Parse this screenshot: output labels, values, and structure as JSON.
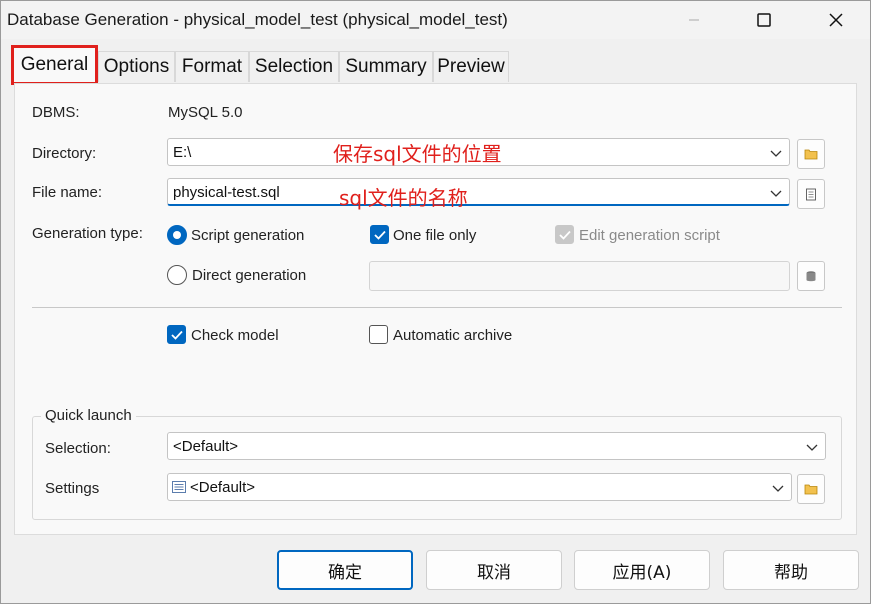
{
  "window": {
    "title": "Database Generation - physical_model_test (physical_model_test)"
  },
  "tabs": [
    {
      "label": "General",
      "active": true
    },
    {
      "label": "Options"
    },
    {
      "label": "Format"
    },
    {
      "label": "Selection"
    },
    {
      "label": "Summary"
    },
    {
      "label": "Preview"
    }
  ],
  "general": {
    "dbms_label": "DBMS:",
    "dbms_value": "MySQL 5.0",
    "directory_label": "Directory:",
    "directory_value": "E:\\",
    "directory_annotation": "保存sql文件的位置",
    "filename_label": "File name:",
    "filename_value": "physical-test.sql",
    "filename_annotation": "sql文件的名称",
    "generation_type_label": "Generation type:",
    "script_generation": "Script generation",
    "one_file_only": "One file only",
    "edit_generation_script": "Edit generation script",
    "direct_generation": "Direct generation",
    "check_model": "Check model",
    "automatic_archive": "Automatic archive"
  },
  "quick_launch": {
    "title": "Quick launch",
    "selection_label": "Selection:",
    "selection_value": "<Default>",
    "settings_label": "Settings",
    "settings_value": "<Default>"
  },
  "buttons": {
    "ok": "确定",
    "cancel": "取消",
    "apply": "应用(A)",
    "help": "帮助"
  },
  "colors": {
    "accent": "#0067c0",
    "annotation": "#e0201c"
  }
}
